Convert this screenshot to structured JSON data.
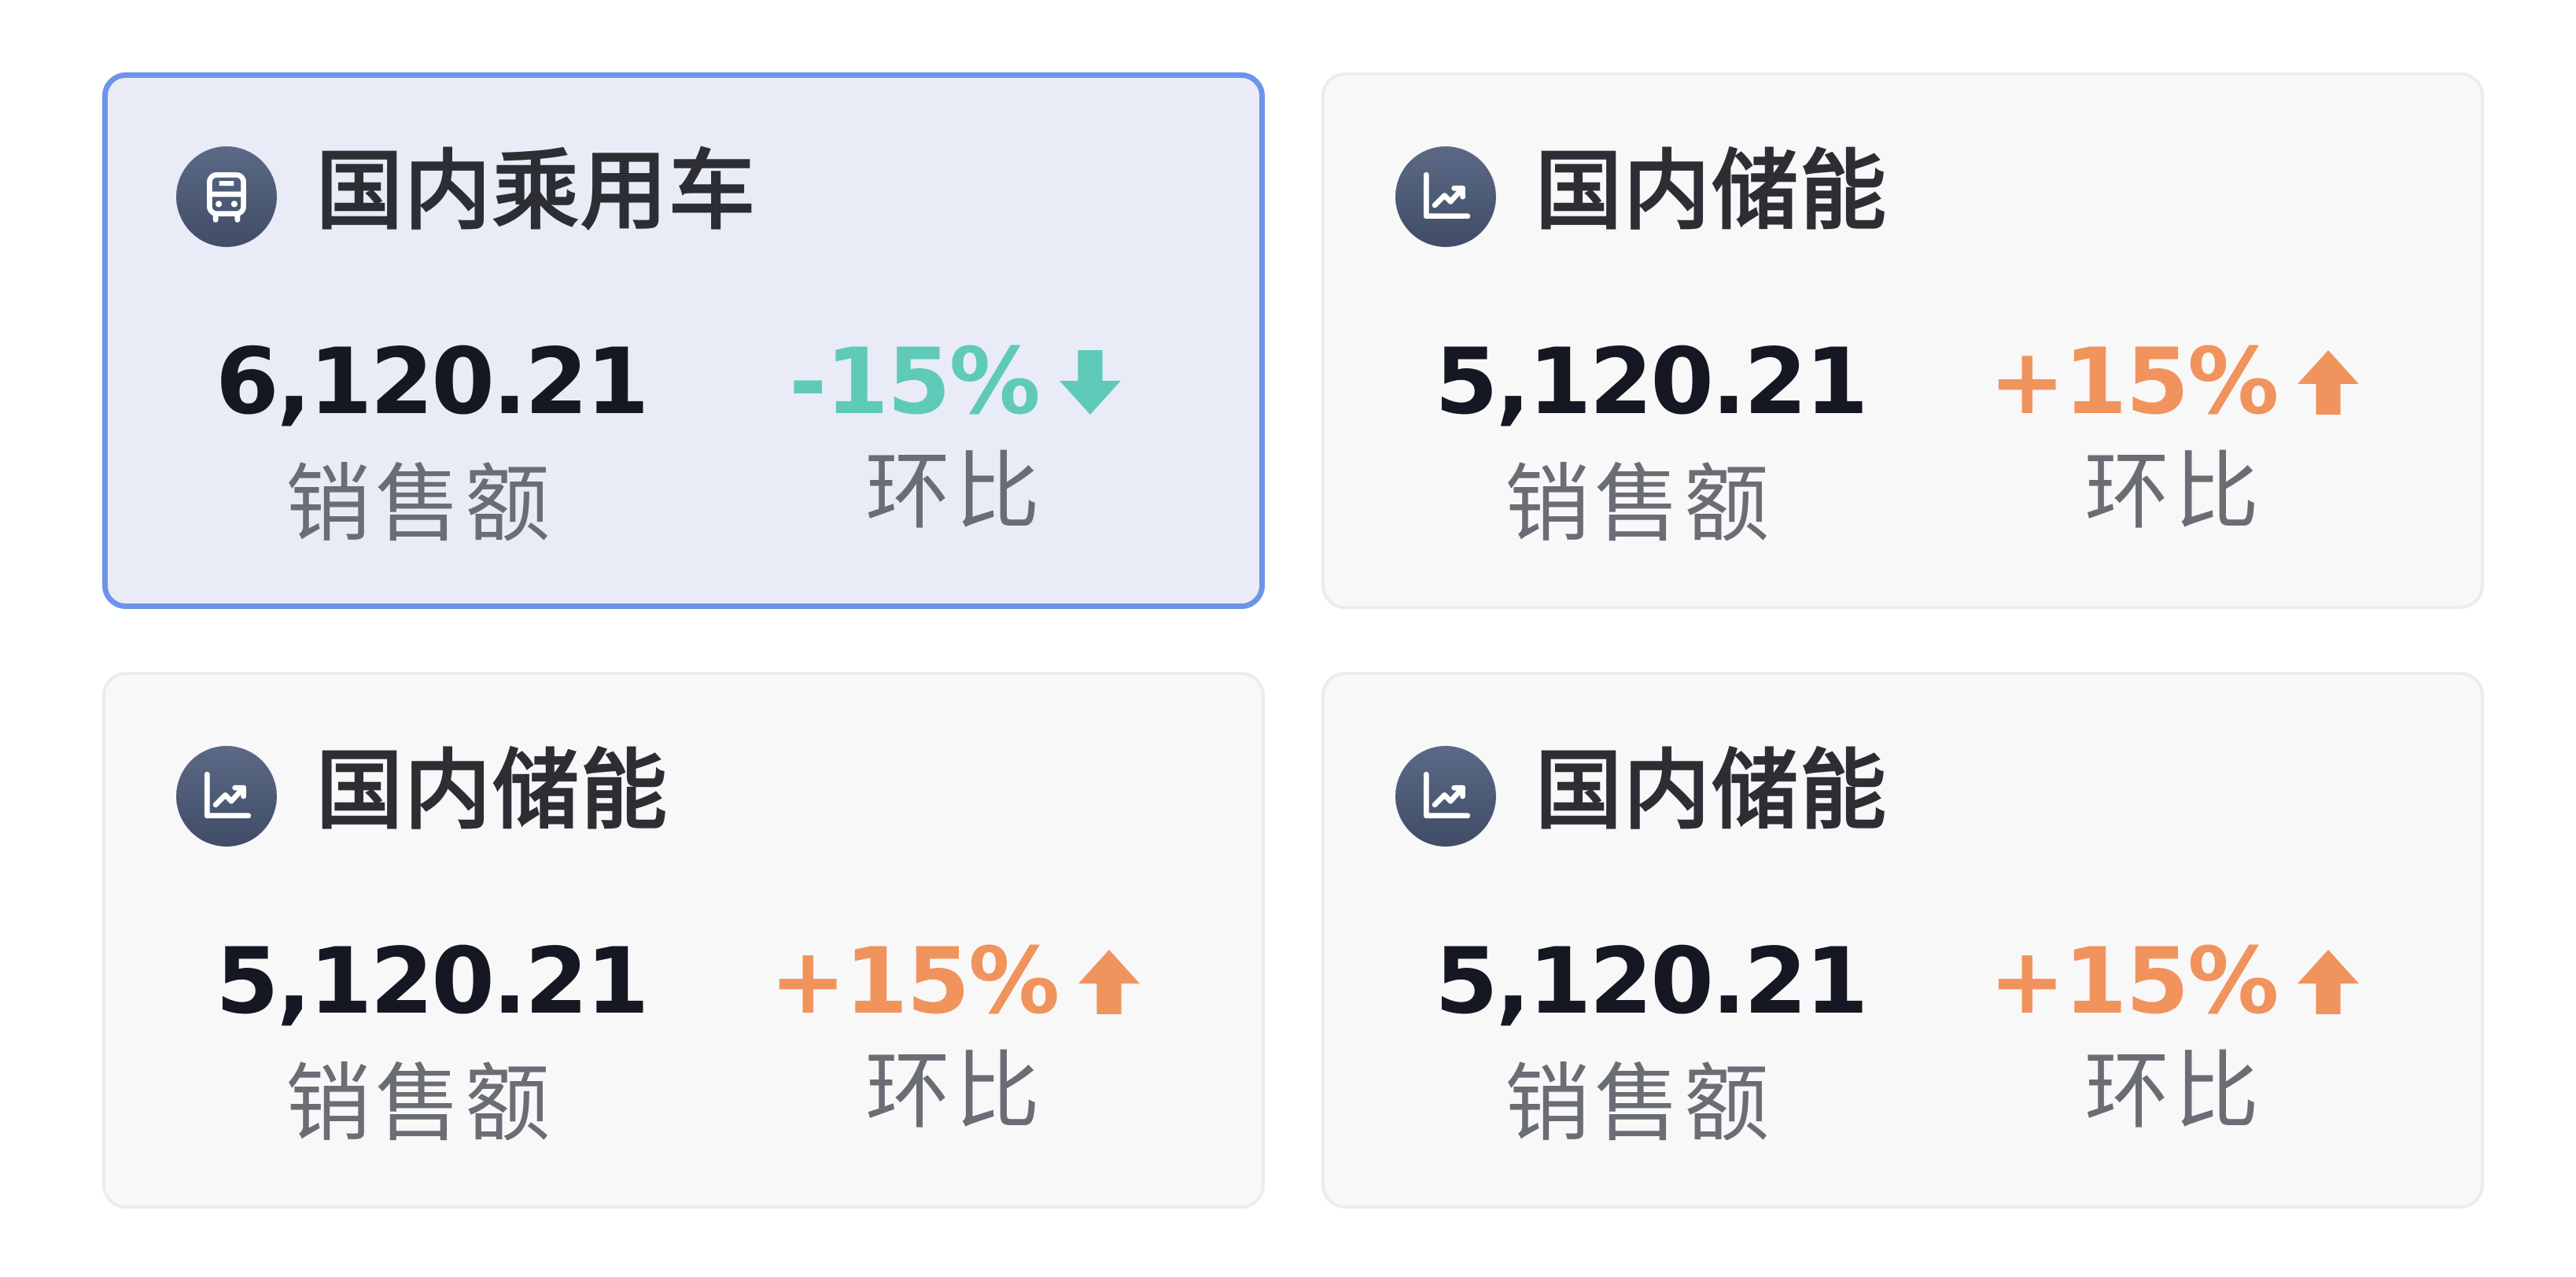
{
  "cards": [
    {
      "icon": "bus-icon",
      "title": "国内乘用车",
      "sales_value": "6,120.21",
      "sales_label": "销售额",
      "change_value": "-15%",
      "change_direction": "down",
      "change_label": "环比",
      "selected": true
    },
    {
      "icon": "trend-chart-icon",
      "title": "国内储能",
      "sales_value": "5,120.21",
      "sales_label": "销售额",
      "change_value": "+15%",
      "change_direction": "up",
      "change_label": "环比",
      "selected": false
    },
    {
      "icon": "trend-chart-icon",
      "title": "国内储能",
      "sales_value": "5,120.21",
      "sales_label": "销售额",
      "change_value": "+15%",
      "change_direction": "up",
      "change_label": "环比",
      "selected": false
    },
    {
      "icon": "trend-chart-icon",
      "title": "国内储能",
      "sales_value": "5,120.21",
      "sales_label": "销售额",
      "change_value": "+15%",
      "change_direction": "up",
      "change_label": "环比",
      "selected": false
    }
  ],
  "colors": {
    "selected_border": "#6d94ea",
    "selected_background": "#e9ecf7",
    "down": "#5fcab8",
    "up": "#f1935c",
    "icon_background": "#4a5672"
  }
}
